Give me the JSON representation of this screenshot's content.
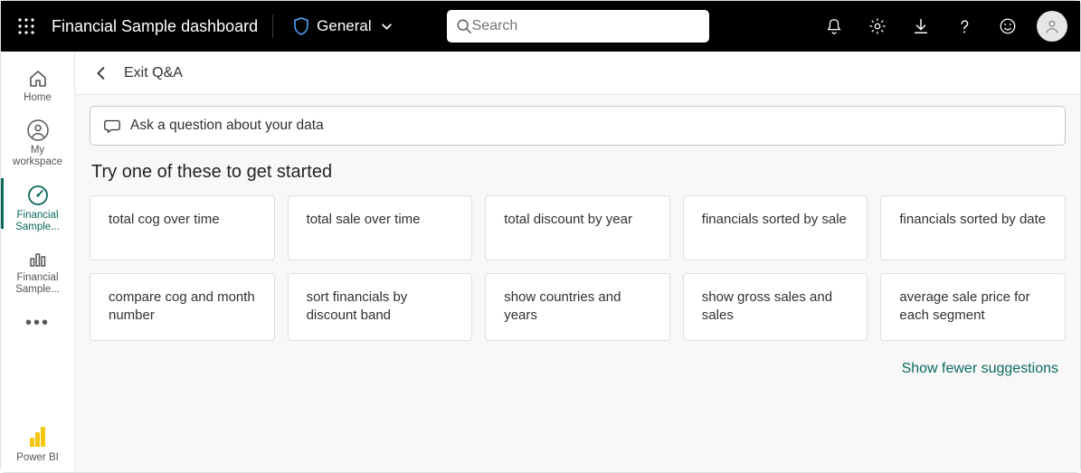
{
  "header": {
    "title": "Financial Sample  dashboard",
    "sensitivity_label": "General",
    "search_placeholder": "Search"
  },
  "sidebar": {
    "home": "Home",
    "my_workspace": "My workspace",
    "financial_sample_active": "Financial Sample...",
    "financial_sample_report": "Financial Sample...",
    "powerbi": "Power BI"
  },
  "subheader": {
    "exit": "Exit Q&A"
  },
  "qna": {
    "placeholder": "Ask a question about your data",
    "try_heading": "Try one of these to get started",
    "show_fewer": "Show fewer suggestions",
    "suggestions": [
      "total cog over time",
      "total sale over time",
      "total discount by year",
      "financials sorted by sale",
      "financials sorted by date",
      "compare cog and month number",
      "sort financials by discount band",
      "show countries and years",
      "show gross sales and sales",
      "average sale price for each segment"
    ]
  }
}
